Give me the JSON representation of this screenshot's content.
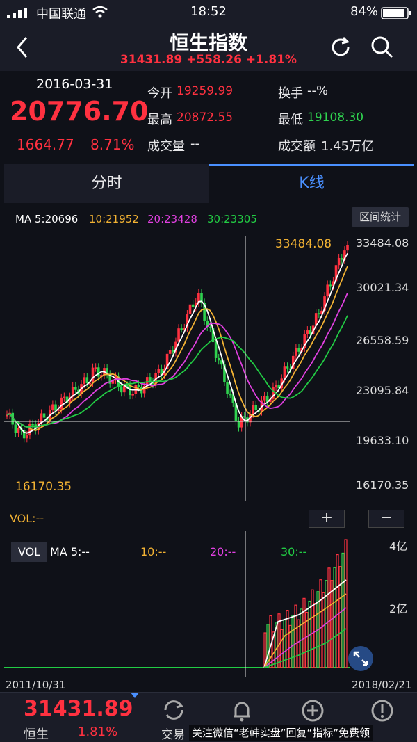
{
  "status_bar": {
    "carrier": "中国联通",
    "time": "18:52",
    "battery": "84%"
  },
  "nav": {
    "title": "恒生指数",
    "subtitle": "31431.89 +558.26 +1.81%",
    "back_icon": "chevron-left-icon",
    "refresh_icon": "refresh-icon",
    "search_icon": "search-icon"
  },
  "quote": {
    "date": "2016-03-31",
    "price": "20776.70",
    "change": "1664.77",
    "change_pct": "8.71%",
    "open_label": "今开",
    "open_value": "19259.99",
    "high_label": "最高",
    "high_value": "20872.55",
    "volume_label": "成交量",
    "volume_value": "--",
    "turnover_label": "换手",
    "turnover_value": "--%",
    "low_label": "最低",
    "low_value": "19108.30",
    "amount_label": "成交额",
    "amount_value": "1.45万亿"
  },
  "tabs": [
    {
      "label": "分时",
      "active": false
    },
    {
      "label": "K线",
      "active": true
    }
  ],
  "ma_legend": {
    "ma5": "MA 5:20696",
    "ma10": "10:21952",
    "ma20": "20:23428",
    "ma30": "30:23305",
    "range_button": "区间统计"
  },
  "price_axis": [
    "33484.08",
    "30021.34",
    "26558.59",
    "23095.84",
    "19633.10",
    "16170.35"
  ],
  "annotations": {
    "high_label": "33484.08",
    "low_label": "16170.35"
  },
  "volume": {
    "label": "VOL:--",
    "plus": "+",
    "minus": "−",
    "tag": "VOL",
    "ma5": "MA 5:--",
    "ma10": "10:--",
    "ma20": "20:--",
    "ma30": "30:--",
    "axis_top": "4亿",
    "axis_mid": "2亿"
  },
  "date_range": {
    "start": "2011/10/31",
    "end": "2018/02/21"
  },
  "bottom_bar": {
    "price": "31431.89",
    "name": "恒生",
    "pct": "1.81%",
    "trade_label": "交易",
    "watermark": "关注微信“老韩实盘”回复“指标”免费领"
  },
  "colors": {
    "up": "#ff3140",
    "down": "#2fd24f",
    "ma5": "#ffffff",
    "ma10": "#f2b233",
    "ma20": "#e040e0",
    "ma30": "#22cc44",
    "accent": "#4a90ff"
  }
}
